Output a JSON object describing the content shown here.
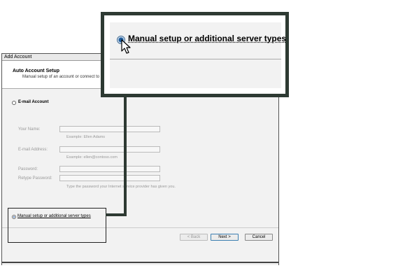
{
  "dialog": {
    "title": "Add Account",
    "header_title": "Auto Account Setup",
    "header_subtitle": "Manual setup of an account or connect to"
  },
  "email_account": {
    "label": "E-mail Account",
    "selected": false
  },
  "fields": {
    "your_name": {
      "label": "Your Name:",
      "hint": "Example: Ellen Adams"
    },
    "email_address": {
      "label": "E-mail Address:",
      "hint": "Example: ellen@contoso.com"
    },
    "password": {
      "label": "Password:"
    },
    "retype_password": {
      "label": "Retype Password:",
      "hint": "Type the password your Internet service provider has given you."
    }
  },
  "manual_setup": {
    "label": "Manual setup or additional server types",
    "selected": true
  },
  "buttons": {
    "back": "< Back",
    "next": "Next >",
    "cancel": "Cancel"
  },
  "callout": {
    "label": "Manual setup or additional server types"
  },
  "colors": {
    "callout_border": "#2e3a33",
    "radio_accent": "#1f5c9c",
    "primary_button_border": "#3c7fb1"
  }
}
